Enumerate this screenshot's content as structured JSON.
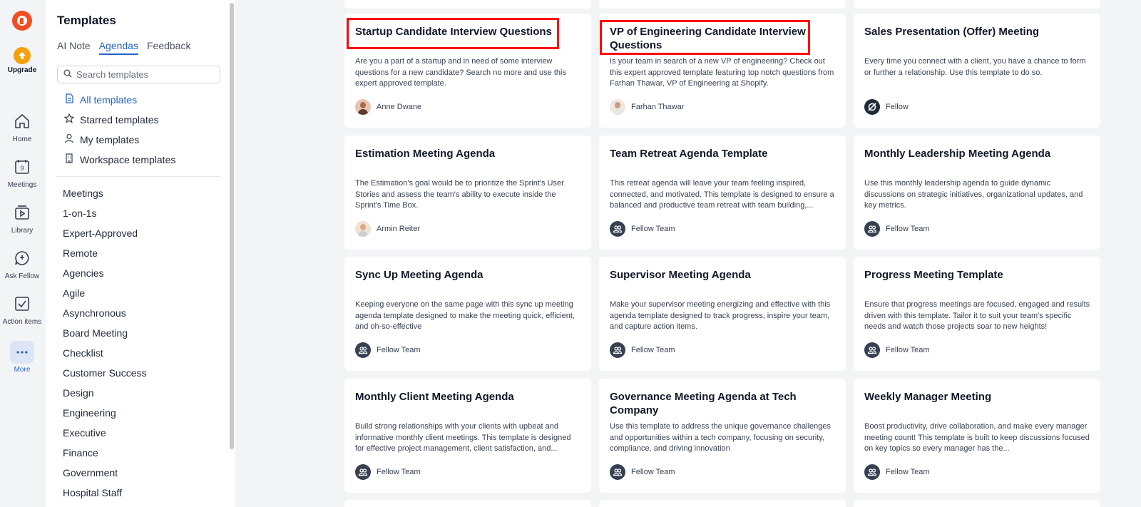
{
  "rail": {
    "upgrade": "Upgrade",
    "items": [
      {
        "label": "Home",
        "icon": "home-icon"
      },
      {
        "label": "Meetings",
        "icon": "calendar-icon",
        "badge": "9"
      },
      {
        "label": "Library",
        "icon": "library-icon"
      },
      {
        "label": "Ask Fellow",
        "icon": "ask-fellow-icon"
      },
      {
        "label": "Action items",
        "icon": "checkbox-icon"
      },
      {
        "label": "More",
        "icon": "more-icon"
      }
    ]
  },
  "panel": {
    "title": "Templates",
    "tabs": [
      "AI Note",
      "Agendas",
      "Feedback"
    ],
    "active_tab": "Agendas",
    "search_placeholder": "Search templates",
    "filters": [
      "All templates",
      "Starred templates",
      "My templates",
      "Workspace templates"
    ],
    "categories": [
      "Meetings",
      "1-on-1s",
      "Expert-Approved",
      "Remote",
      "Agencies",
      "Agile",
      "Asynchronous",
      "Board Meeting",
      "Checklist",
      "Customer Success",
      "Design",
      "Engineering",
      "Executive",
      "Finance",
      "Government",
      "Hospital Staff"
    ]
  },
  "cards": [
    {
      "title": "Startup Candidate Interview Questions",
      "desc": "Are you a part of a startup and in need of some interview questions for a new candidate? Search no more and use this expert approved template.",
      "author": "Anne Dwane",
      "avatar": "person"
    },
    {
      "title": "VP of Engineering Candidate Interview Questions",
      "desc": "Is your team in search of a new VP of engineering? Check out this expert approved template featuring top notch questions from Farhan Thawar, VP of Engineering at Shopify.",
      "author": "Farhan Thawar",
      "avatar": "person"
    },
    {
      "title": "Sales Presentation (Offer) Meeting",
      "desc": "Every time you connect with a client, you have a chance to form or further a relationship. Use this template to do so.",
      "author": "Fellow",
      "avatar": "fellow"
    },
    {
      "title": "Estimation Meeting Agenda",
      "desc": "The Estimation's goal would be to prioritize the Sprint's User Stories and assess the team's ability to execute inside the Sprint's Time Box.",
      "author": "Armin Reiter",
      "avatar": "person"
    },
    {
      "title": "Team Retreat Agenda Template",
      "desc": "This retreat agenda will leave your team feeling inspired, connected, and motivated. This template is designed to ensure a balanced and productive team retreat with team building,...",
      "author": "Fellow Team",
      "avatar": "team"
    },
    {
      "title": "Monthly Leadership Meeting Agenda",
      "desc": "Use this monthly leadership agenda to guide dynamic discussions on strategic initiatives, organizational updates, and key metrics.",
      "author": "Fellow Team",
      "avatar": "team"
    },
    {
      "title": "Sync Up Meeting Agenda",
      "desc": "Keeping everyone on the same page with this sync up meeting agenda template designed to make the meeting quick, efficient, and oh-so-effective",
      "author": "Fellow Team",
      "avatar": "team"
    },
    {
      "title": "Supervisor Meeting Agenda",
      "desc": "Make your supervisor meeting energizing and effective with this agenda template designed to track progress, inspire your team, and capture action items.",
      "author": "Fellow Team",
      "avatar": "team"
    },
    {
      "title": "Progress Meeting Template",
      "desc": "Ensure that progress meetings are focused, engaged and results driven with this template. Tailor it to suit your team's specific needs and watch those projects soar to new heights!",
      "author": "Fellow Team",
      "avatar": "team"
    },
    {
      "title": "Monthly Client Meeting Agenda",
      "desc": "Build strong relationships with your clients with upbeat and informative monthly client meetings. This template is designed for effective project management, client satisfaction, and...",
      "author": "Fellow Team",
      "avatar": "team"
    },
    {
      "title": "Governance Meeting Agenda at Tech Company",
      "desc": "Use this template to address the unique governance challenges and opportunities within a tech company, focusing on security, compliance, and driving innovation",
      "author": "Fellow Team",
      "avatar": "team"
    },
    {
      "title": "Weekly Manager Meeting",
      "desc": "Boost productivity, drive collaboration, and make every manager meeting count! This template is built to keep discussions focused on key topics so every manager has the...",
      "author": "Fellow Team",
      "avatar": "team"
    }
  ],
  "colors": {
    "accent": "#2563c9",
    "brand": "#f04e23",
    "upgrade": "#f5a00b",
    "highlight": "#ff0000"
  }
}
